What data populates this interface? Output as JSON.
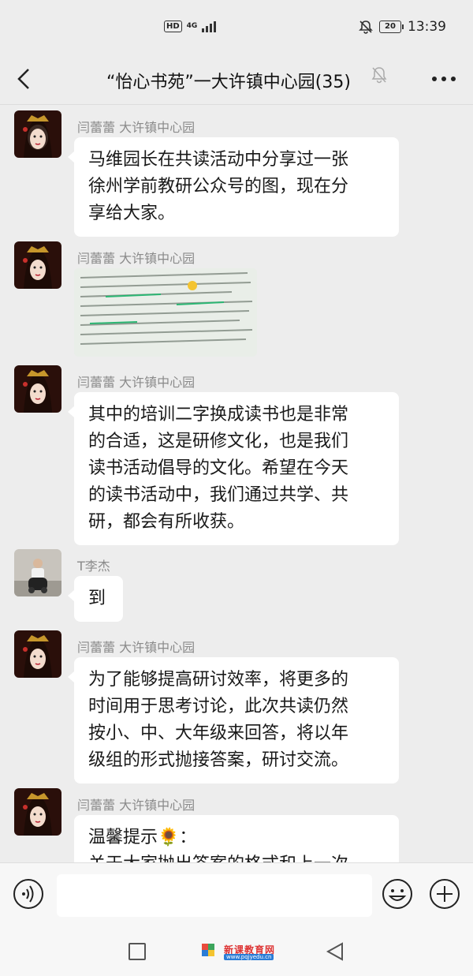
{
  "status_bar": {
    "hd": "HD",
    "network": "4G",
    "battery": "20",
    "time": "13:39",
    "icons": [
      "mute-icon",
      "battery-icon",
      "signal-icon"
    ]
  },
  "header": {
    "title": "“怡心书苑”一大许镇中心园(35)"
  },
  "messages": [
    {
      "sender": "闫蕾蕾  大许镇中心园",
      "lines": [
        "马维园长在共读活动中分享过一张",
        "徐州学前教研公众号的图，现在分",
        "享给大家。"
      ]
    },
    {
      "sender": "闫蕾蕾  大许镇中心园",
      "type": "image"
    },
    {
      "sender": "闫蕾蕾  大许镇中心园",
      "lines": [
        "其中的培训二字换成读书也是非常",
        "的合适，这是研修文化，也是我们",
        "读书活动倡导的文化。希望在今天",
        "的读书活动中，我们通过共学、共",
        "研，都会有所收获。"
      ]
    },
    {
      "sender": "T李杰",
      "lines": [
        "到"
      ]
    },
    {
      "sender": "闫蕾蕾  大许镇中心园",
      "lines": [
        "为了能够提高研讨效率，将更多的",
        "时间用于思考讨论，此次共读仍然",
        "按小、中、大年级来回答，将以年",
        "级组的形式抛接答案，研讨交流。"
      ]
    },
    {
      "sender": "闫蕾蕾  大许镇中心园",
      "lines": [
        "温馨提示🌻：",
        "关于大家抛出答案的格式和上一次"
      ]
    }
  ],
  "input_bar": {
    "text_value": "",
    "icons": [
      "voice-icon",
      "emoji-icon",
      "plus-icon"
    ]
  },
  "watermark": {
    "text": "新课教育网",
    "url": "www.pqjyedu.cn"
  },
  "colors": {
    "background": "#ededed",
    "bubble": "#ffffff",
    "sender": "#8a8a8a"
  }
}
